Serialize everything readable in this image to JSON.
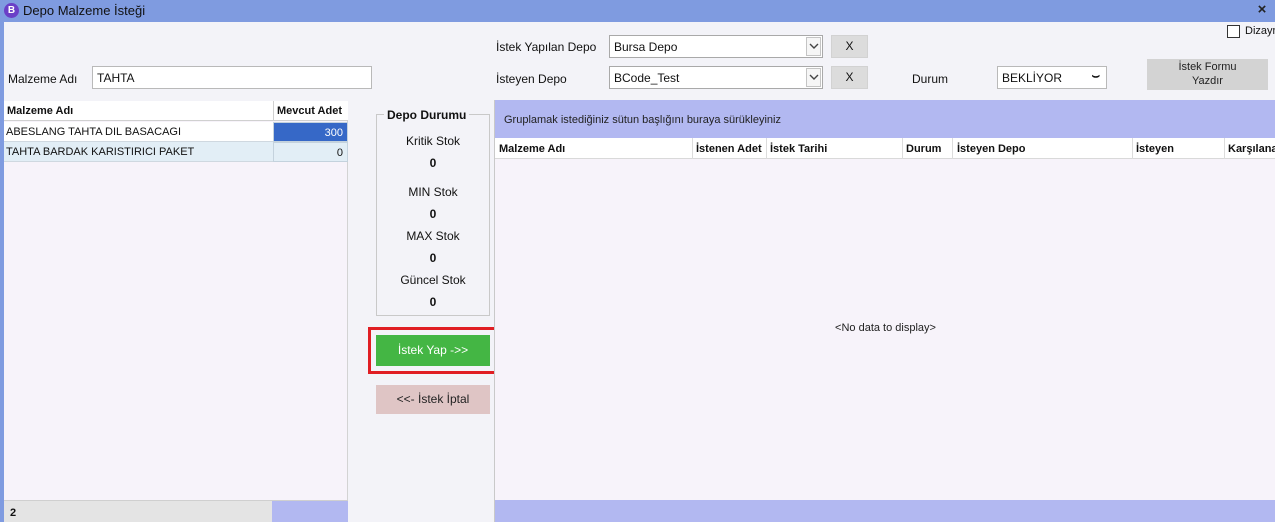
{
  "window": {
    "title": "Depo Malzeme İsteği",
    "app_icon_letter": "B",
    "close_glyph": "×"
  },
  "checkbox": {
    "label": "Dizayn",
    "checked": false
  },
  "form": {
    "malzeme_adi_label": "Malzeme Adı",
    "malzeme_adi_value": "TAHTA",
    "istek_yapilan_depo_label": "İstek Yapılan Depo",
    "istek_yapilan_depo_value": "Bursa Depo",
    "isteyen_depo_label": "İsteyen Depo",
    "isteyen_depo_value": "BCode_Test",
    "clear_label": "X",
    "durum_label": "Durum",
    "durum_value": "BEKLİYOR",
    "print_button_line1": "İstek Formu",
    "print_button_line2": "Yazdır"
  },
  "left_grid": {
    "columns": [
      "Malzeme Adı",
      "Mevcut Adet"
    ],
    "rows": [
      {
        "name": "ABESLANG TAHTA DIL BASACAGI",
        "qty": "300"
      },
      {
        "name": "TAHTA BARDAK KARISTIRICI PAKET",
        "qty": "0"
      }
    ],
    "footer_count": "2"
  },
  "depo_durumu": {
    "title": "Depo Durumu",
    "items": [
      {
        "label": "Kritik Stok",
        "value": "0"
      },
      {
        "label": "MIN Stok",
        "value": "0"
      },
      {
        "label": "MAX Stok",
        "value": "0"
      },
      {
        "label": "Güncel Stok",
        "value": "0"
      }
    ]
  },
  "actions": {
    "request_label": "İstek Yap ->>",
    "cancel_label": "<<- İstek İptal"
  },
  "right_grid": {
    "group_panel_text": "Gruplamak istediğiniz sütun başlığını buraya sürükleyiniz",
    "columns": [
      "Malzeme Adı",
      "İstenen Adet",
      "İstek Tarihi",
      "Durum",
      "İsteyen Depo",
      "İsteyen",
      "Karşılanan"
    ],
    "no_data_text": "<No data to display>"
  },
  "colors": {
    "titlebar": "#7f9be0",
    "selection": "#3668c7",
    "request_button": "#44b644",
    "highlight": "#e01e23",
    "group_panel": "#b2b8f1"
  }
}
